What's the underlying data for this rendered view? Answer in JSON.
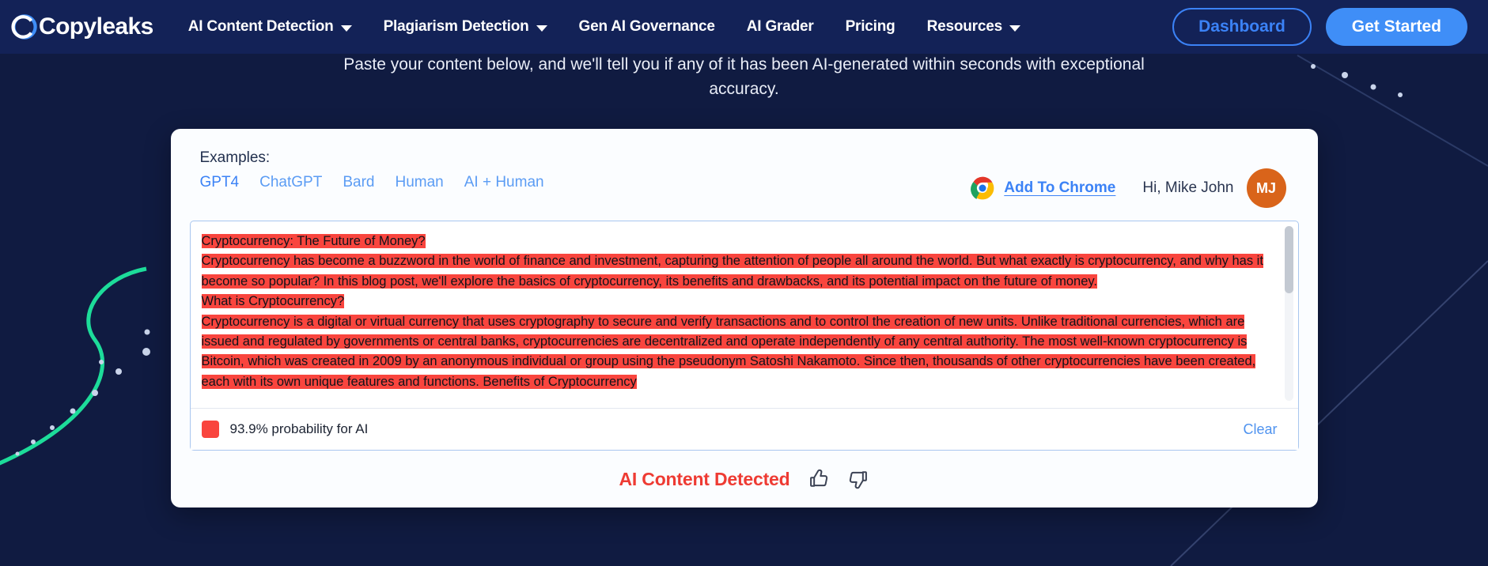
{
  "nav": {
    "logo_text": "Copyleaks",
    "logo_icon": "copyleaks-c-logo-icon",
    "links": [
      {
        "label": "AI Content Detection",
        "has_caret": true
      },
      {
        "label": "Plagiarism Detection",
        "has_caret": true
      },
      {
        "label": "Gen AI Governance",
        "has_caret": false
      },
      {
        "label": "AI Grader",
        "has_caret": false
      },
      {
        "label": "Pricing",
        "has_caret": false
      },
      {
        "label": "Resources",
        "has_caret": true
      }
    ],
    "dashboard_label": "Dashboard",
    "get_started_label": "Get Started"
  },
  "hero": {
    "subtitle": "Paste your content below, and we'll tell you if any of it has been AI-generated within seconds with exceptional accuracy."
  },
  "card": {
    "examples_label": "Examples:",
    "example_tabs": [
      {
        "label": "GPT4",
        "active": true
      },
      {
        "label": "ChatGPT",
        "active": false
      },
      {
        "label": "Bard",
        "active": false
      },
      {
        "label": "Human",
        "active": false
      },
      {
        "label": "AI + Human",
        "active": false
      }
    ],
    "chrome": {
      "icon": "chrome-logo-icon",
      "label": "Add To Chrome"
    },
    "user": {
      "greeting": "Hi, Mike John",
      "avatar_initials": "MJ",
      "avatar_color": "#d9641a"
    },
    "editor": {
      "paragraphs": [
        "Cryptocurrency: The Future of Money?",
        "Cryptocurrency has become a buzzword in the world of finance and investment, capturing the attention of people all around the world. But what exactly is cryptocurrency, and why has it become so popular? In this blog post, we'll explore the basics of cryptocurrency, its benefits and drawbacks, and its potential impact on the future of money.",
        "What is Cryptocurrency?",
        "Cryptocurrency is a digital or virtual currency that uses cryptography to secure and verify transactions and to control the creation of new units. Unlike traditional currencies, which are issued and regulated by governments or central banks, cryptocurrencies are decentralized and operate independently of any central authority. The most well-known cryptocurrency is Bitcoin, which was created in 2009 by an anonymous individual or group using the pseudonym Satoshi Nakamoto. Since then, thousands of other cryptocurrencies have been created, each with its own unique features and functions. Benefits of Cryptocurrency"
      ],
      "highlight_color": "#f9453e",
      "probability_text": "93.9% probability for AI",
      "clear_label": "Clear"
    },
    "footer": {
      "verdict": "AI Content Detected",
      "verdict_color": "#ee3b33",
      "thumbs_up_icon": "thumbs-up-icon",
      "thumbs_down_icon": "thumbs-down-icon"
    }
  }
}
